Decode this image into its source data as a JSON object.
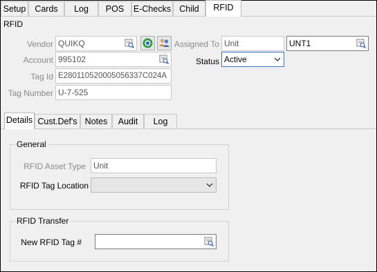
{
  "top_tabs": [
    "Setup",
    "Cards",
    "Log",
    "POS",
    "E-Checks",
    "Child",
    "RFID"
  ],
  "active_top_tab": "RFID",
  "section_title": "RFID",
  "form": {
    "vendor_label": "Vendor",
    "vendor_value": "QUIKQ",
    "account_label": "Account",
    "account_value": "995102",
    "tag_id_label": "Tag Id",
    "tag_id_value": "E28011052000505633 7C024A",
    "tag_number_label": "Tag Number",
    "tag_number_value": "U-7-525",
    "assigned_to_label": "Assigned To",
    "assigned_to_type": "Unit",
    "assigned_to_value": "UNT1",
    "status_label": "Status",
    "status_value": "Active"
  },
  "detail_tabs": [
    "Details",
    "Cust.Def's",
    "Notes",
    "Audit",
    "Log"
  ],
  "active_detail_tab": "Details",
  "general": {
    "title": "General",
    "asset_type_label": "RFID Asset Type",
    "asset_type_value": "Unit",
    "tag_location_label": "RFID Tag Location",
    "tag_location_value": ""
  },
  "transfer": {
    "title": "RFID Transfer",
    "new_tag_label": "New RFID Tag #",
    "new_tag_value": ""
  },
  "icons": {
    "lookup": "magnifier-lookup-icon",
    "refresh": "refresh-globe-icon",
    "users": "users-icon",
    "dropdown": "chevron-down-icon"
  },
  "colors": {
    "focus_border": "#2f74c9",
    "background": "#f0f0f0"
  }
}
